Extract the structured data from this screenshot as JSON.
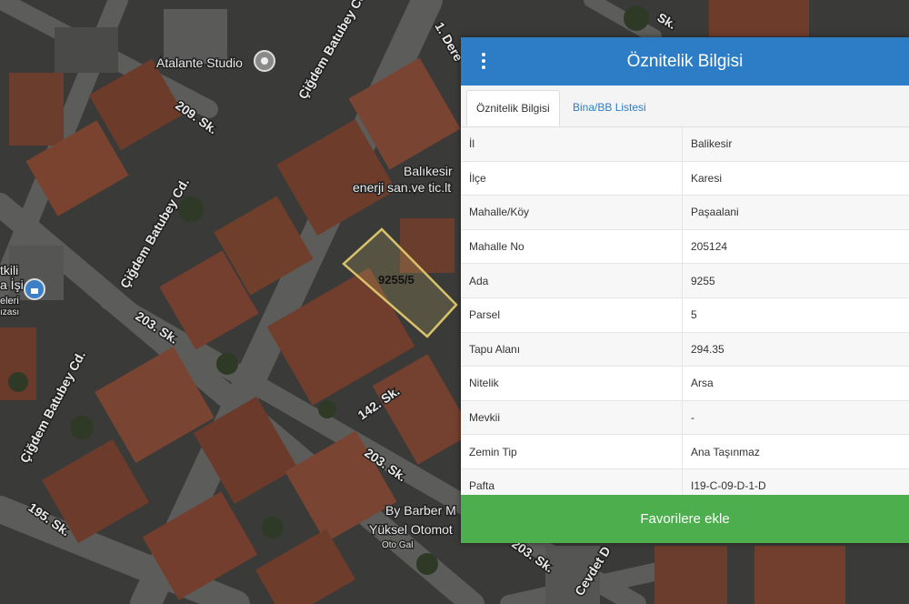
{
  "map": {
    "street_labels": [
      "1. Dere",
      "Çiğdem Batubey Cd.",
      "209. Sk.",
      "Çiğdem Batubey Cd.",
      "203. Sk.",
      "Çiğdem Batubey Cd.",
      "142. Sk.",
      "203. Sk.",
      "195. Sk.",
      "203. Sk.",
      "Cevdet D",
      "Sk."
    ],
    "poi_labels": [
      "Atalante Studio",
      "Balıkesir",
      "enerji san.ve tic.lt",
      "By Barber M",
      "Yüksel Otomot",
      "Oto Gal",
      "tkili",
      "a İşi",
      "eleri",
      "ızası"
    ],
    "parcel_label": "9255/5",
    "colors": {
      "parcel_outline": "#d8c36a",
      "poi_pin": "#3b7fc4"
    }
  },
  "panel": {
    "title": "Öznitelik Bilgisi",
    "menu_icon": "vertical-dots-icon",
    "tabs": [
      {
        "label": "Öznitelik Bilgisi",
        "active": true
      },
      {
        "label": "Bina/BB Listesi",
        "active": false
      }
    ],
    "rows": [
      {
        "key": "İl",
        "value": "Balikesir"
      },
      {
        "key": "İlçe",
        "value": "Karesi"
      },
      {
        "key": "Mahalle/Köy",
        "value": "Paşaalani"
      },
      {
        "key": "Mahalle No",
        "value": "205124"
      },
      {
        "key": "Ada",
        "value": "9255"
      },
      {
        "key": "Parsel",
        "value": "5"
      },
      {
        "key": "Tapu Alanı",
        "value": "294.35"
      },
      {
        "key": "Nitelik",
        "value": "Arsa"
      },
      {
        "key": "Mevkii",
        "value": "-"
      },
      {
        "key": "Zemin Tip",
        "value": "Ana Taşınmaz"
      },
      {
        "key": "Pafta",
        "value": "I19-C-09-D-1-D"
      }
    ],
    "favorite_button": "Favorilere ekle",
    "colors": {
      "header": "#2d7dc6",
      "button": "#4cae4c",
      "tab_link": "#2d7dc6"
    }
  }
}
